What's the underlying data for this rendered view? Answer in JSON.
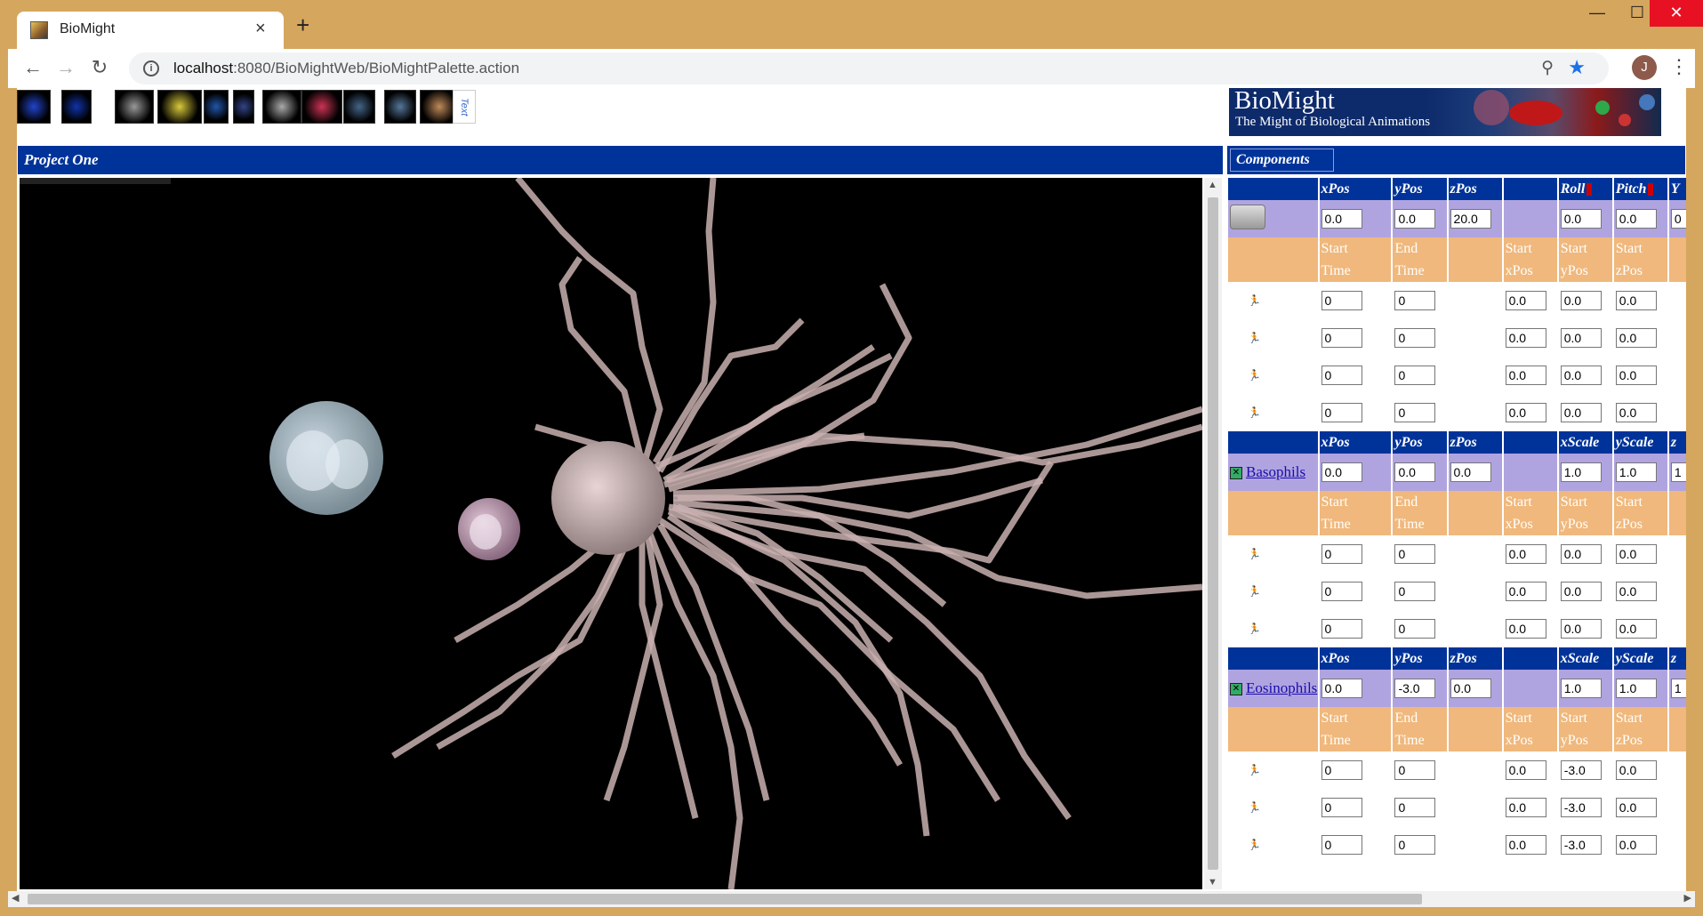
{
  "browser": {
    "tab_title": "BioMight",
    "new_tab_label": "+",
    "tab_close_label": "×",
    "url_host": "localhost",
    "url_rest": ":8080/BioMightWeb/BioMightPalette.action",
    "avatar_initial": "J",
    "window_controls": {
      "minimize": "—",
      "maximize": "☐",
      "close": "✕"
    },
    "icons": {
      "back": "back-arrow-icon",
      "forward": "forward-arrow-icon",
      "reload": "reload-icon",
      "info": "info-icon",
      "zoom": "zoom-icon",
      "star": "bookmark-star-icon",
      "menu": "kebab-menu-icon"
    }
  },
  "palette": {
    "items": [
      {
        "name": "palette-molecule-chain",
        "color": "#2244cc"
      },
      {
        "name": "palette-blue-molecule",
        "color": "#1133aa"
      },
      {
        "name": "palette-dna-helix",
        "color": "#999999"
      },
      {
        "name": "palette-cell",
        "color": "#d8c83a"
      },
      {
        "name": "palette-dots",
        "color": "#2255aa"
      },
      {
        "name": "palette-column",
        "color": "#334488"
      },
      {
        "name": "palette-sphere",
        "color": "#aaaaaa"
      },
      {
        "name": "palette-squares",
        "color": "#cc3355"
      },
      {
        "name": "palette-tissue",
        "color": "#446688"
      },
      {
        "name": "palette-organ",
        "color": "#557799"
      },
      {
        "name": "palette-body",
        "color": "#c08a5a"
      }
    ],
    "text_tool_label": "Text"
  },
  "logo": {
    "title": "BioMight",
    "subtitle": "The Might of Biological Animations"
  },
  "project": {
    "title": "Project One"
  },
  "components": {
    "button_label": "Components",
    "camera": {
      "headers": [
        "xPos",
        "yPos",
        "zPos",
        "",
        "Roll",
        "Pitch",
        "Y"
      ],
      "values": [
        "0.0",
        "0.0",
        "20.0",
        "",
        "0.0",
        "0.0",
        "0"
      ],
      "sub1": [
        "Start",
        "End",
        "",
        "Start",
        "Start",
        "Start",
        ""
      ],
      "sub2": [
        "Time",
        "Time",
        "",
        "xPos",
        "yPos",
        "zPos",
        ""
      ],
      "keyframes": [
        [
          "0",
          "0",
          "0.0",
          "0.0",
          "0.0"
        ],
        [
          "0",
          "0",
          "0.0",
          "0.0",
          "0.0"
        ],
        [
          "0",
          "0",
          "0.0",
          "0.0",
          "0.0"
        ],
        [
          "0",
          "0",
          "0.0",
          "0.0",
          "0.0"
        ]
      ]
    },
    "groups": [
      {
        "link": "Basophils",
        "headers": [
          "xPos",
          "yPos",
          "zPos",
          "",
          "xScale",
          "yScale",
          "z"
        ],
        "values": [
          "0.0",
          "0.0",
          "0.0",
          "",
          "1.0",
          "1.0",
          "1"
        ],
        "sub1": [
          "Start",
          "End",
          "",
          "Start",
          "Start",
          "Start",
          ""
        ],
        "sub2": [
          "Time",
          "Time",
          "",
          "xPos",
          "yPos",
          "zPos",
          ""
        ],
        "keyframes": [
          [
            "0",
            "0",
            "0.0",
            "0.0",
            "0.0"
          ],
          [
            "0",
            "0",
            "0.0",
            "0.0",
            "0.0"
          ],
          [
            "0",
            "0",
            "0.0",
            "0.0",
            "0.0"
          ]
        ]
      },
      {
        "link": "Eosinophils",
        "headers": [
          "xPos",
          "yPos",
          "zPos",
          "",
          "xScale",
          "yScale",
          "z"
        ],
        "values": [
          "0.0",
          "-3.0",
          "0.0",
          "",
          "1.0",
          "1.0",
          "1"
        ],
        "sub1": [
          "Start",
          "End",
          "",
          "Start",
          "Start",
          "Start",
          ""
        ],
        "sub2": [
          "Time",
          "Time",
          "",
          "xPos",
          "yPos",
          "zPos",
          ""
        ],
        "keyframes": [
          [
            "0",
            "0",
            "0.0",
            "-3.0",
            "0.0"
          ],
          [
            "0",
            "0",
            "0.0",
            "-3.0",
            "0.0"
          ],
          [
            "0",
            "0",
            "0.0",
            "-3.0",
            "0.0"
          ]
        ]
      }
    ]
  }
}
